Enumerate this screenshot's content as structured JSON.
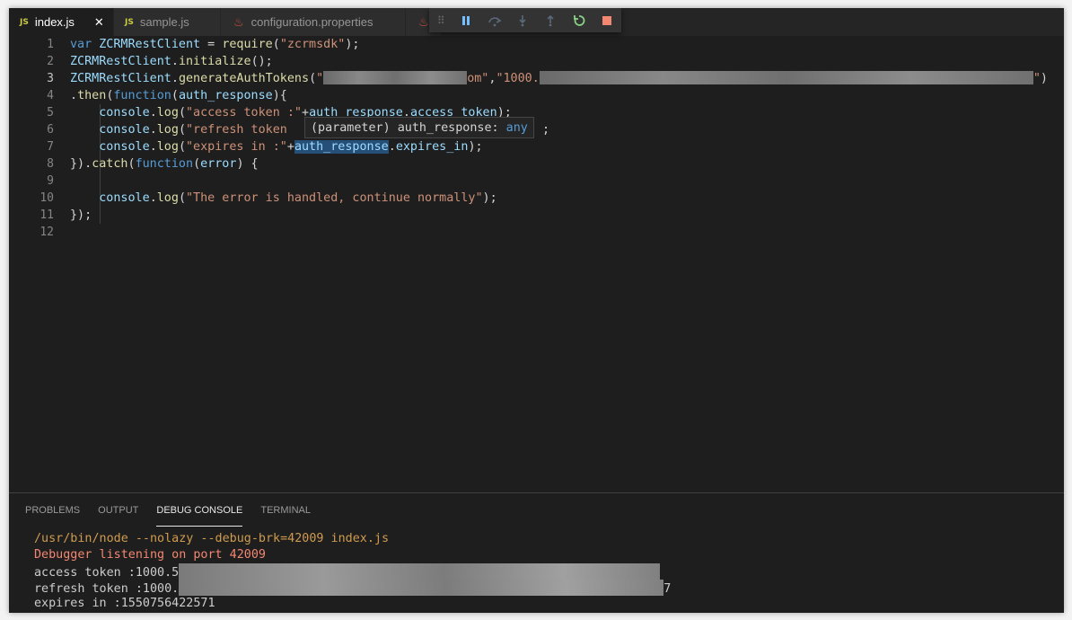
{
  "tabs": [
    {
      "label": "index.js",
      "icon": "JS"
    },
    {
      "label": "sample.js",
      "icon": "JS"
    },
    {
      "label": "configuration.properties",
      "icon": "java-icon"
    }
  ],
  "tab_close_glyph": "✕",
  "debug_toolbar": [
    "pause",
    "step-over",
    "step-into",
    "step-out",
    "restart",
    "stop"
  ],
  "line_numbers": [
    "1",
    "2",
    "3",
    "4",
    "5",
    "6",
    "7",
    "8",
    "9",
    "10",
    "11",
    "12"
  ],
  "code": {
    "l1": {
      "kw": "var",
      "name": " ZCRMRestClient",
      "eq": " = ",
      "fn": "require",
      "p1": "(",
      "str": "\"zcrmsdk\"",
      "end": ");"
    },
    "l2": {
      "obj": "ZCRMRestClient",
      "dot": ".",
      "fn": "initialize",
      "end": "();"
    },
    "l3": {
      "obj": "ZCRMRestClient",
      "dot": ".",
      "fn": "generateAuthTokens",
      "p1": "(",
      "s1a": "\"",
      "s1b": "om\"",
      "comma": ",",
      "s2a": "\"1000.",
      "s2b": "\"",
      "end": ")"
    },
    "l4": {
      "dot": ".",
      "fn": "then",
      "p1": "(",
      "kw": "function",
      "p2": "(",
      "param": "auth_response",
      "end": "){"
    },
    "l5": {
      "obj": "console",
      "dot": ".",
      "fn": "log",
      "p1": "(",
      "str": "\"access token :\"",
      "plus": "+",
      "param": "auth_response",
      "dot2": ".",
      "prop": "access_token",
      "end": ");"
    },
    "l6": {
      "obj": "console",
      "dot": ".",
      "fn": "log",
      "p1": "(",
      "str": "\"refresh token"
    },
    "l7": {
      "obj": "console",
      "dot": ".",
      "fn": "log",
      "p1": "(",
      "str": "\"expires in :\"",
      "plus": "+",
      "param": "auth_response",
      "dot2": ".",
      "prop": "expires_in",
      "end": ");"
    },
    "l8": {
      "p0": "}).",
      "fn": "catch",
      "p1": "(",
      "kw": "function",
      "p2": "(",
      "param": "error",
      "end": ") {"
    },
    "l10": {
      "obj": "console",
      "dot": ".",
      "fn": "log",
      "p1": "(",
      "str": "\"The error is handled, continue normally\"",
      "end": ");"
    },
    "l11": {
      "end": "});"
    }
  },
  "hover_tooltip": {
    "prefix": "(parameter) auth_response: ",
    "type": "any",
    "trail": ";"
  },
  "panel_tabs": [
    "PROBLEMS",
    "OUTPUT",
    "DEBUG CONSOLE",
    "TERMINAL"
  ],
  "console_lines": {
    "cmd": "/usr/bin/node --nolazy --debug-brk=42009 index.js",
    "listening": "Debugger listening on port 42009",
    "access": "access token :1000.5",
    "refresh": "refresh token :1000.",
    "refresh_tail": "7",
    "expires": "expires in :1550756422571"
  },
  "colors": {
    "keyword": "#569cd6",
    "variable": "#9cdcfe",
    "function": "#dcdcaa",
    "string": "#ce9178",
    "js_icon": "#cbcb41"
  }
}
